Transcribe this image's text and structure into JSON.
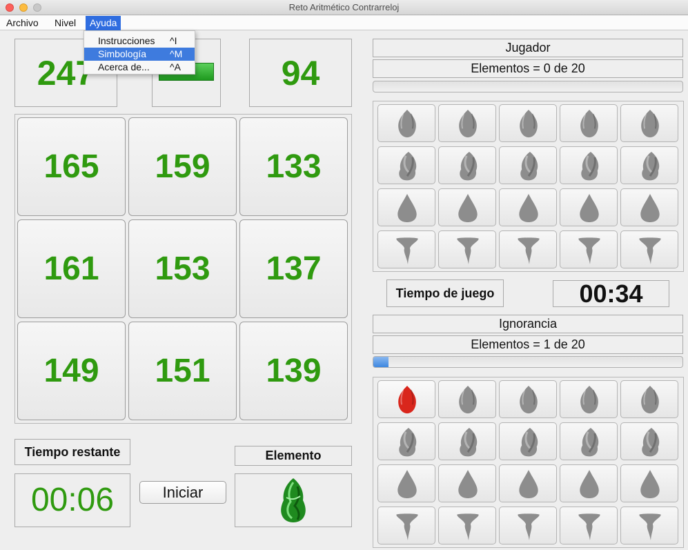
{
  "window": {
    "title": "Reto Aritmético Contrarreloj"
  },
  "menu": {
    "items": [
      "Archivo",
      "Nivel",
      "Ayuda"
    ]
  },
  "dropdown": {
    "items": [
      {
        "label": "Instrucciones",
        "shortcut": "^I"
      },
      {
        "label": "Simbología",
        "shortcut": "^M",
        "highlighted": true
      },
      {
        "label": "Acerca de...",
        "shortcut": "^A"
      }
    ]
  },
  "game": {
    "target_left": "247",
    "target_right": "94",
    "grid": [
      "165",
      "159",
      "133",
      "161",
      "153",
      "137",
      "149",
      "151",
      "139"
    ],
    "tiempo_restante_label": "Tiempo restante",
    "tiempo_restante": "00:06",
    "iniciar_label": "Iniciar",
    "elemento_label": "Elemento",
    "elemento_icon": "green-air-element-icon"
  },
  "jugador": {
    "title": "Jugador",
    "elementos": "Elementos = 0 de 20",
    "progress": 0
  },
  "tiempo_juego": {
    "label": "Tiempo de juego",
    "value": "00:34"
  },
  "ignorancia": {
    "title": "Ignorancia",
    "elementos": "Elementos = 1 de 20",
    "progress": 0.05
  },
  "element_rows": [
    "fire",
    "air",
    "water",
    "earth"
  ],
  "colors": {
    "number_green": "#2f9a0f",
    "accent_blue": "#2f6de0",
    "fire_red": "#d9261c"
  }
}
